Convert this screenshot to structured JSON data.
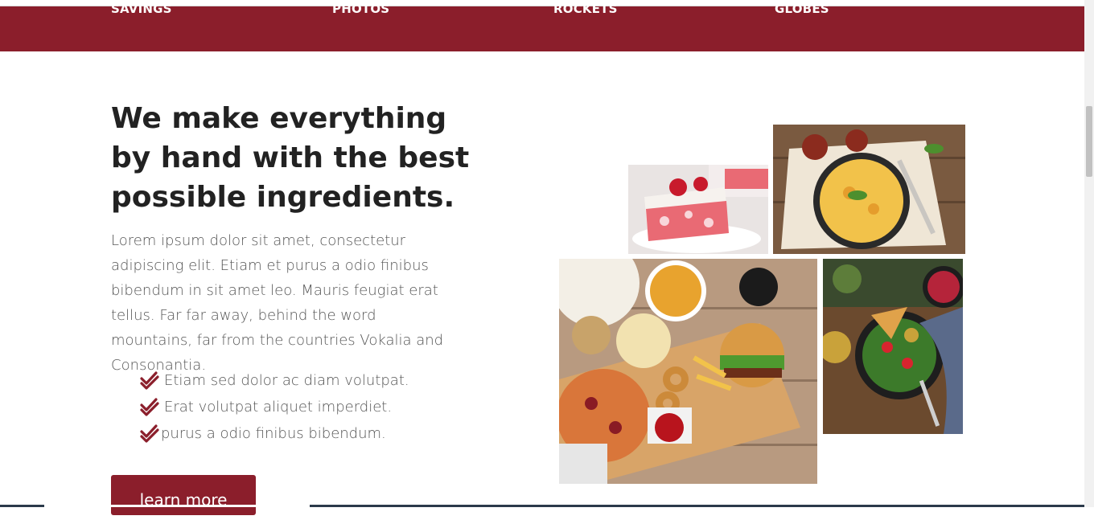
{
  "nav": {
    "items": [
      "SAVINGS",
      "PHOTOS",
      "ROCKETS",
      "GLOBES"
    ]
  },
  "content": {
    "headline": "We make everything by hand with the best possible ingredients.",
    "paragraph": "Lorem ipsum dolor sit amet, consectetur adipiscing elit. Etiam et purus a odio finibus bibendum in sit amet leo. Mauris feugiat erat tellus. Far far away, behind the word mountains, far from the countries Vokalia and Consonantia.",
    "checklist": [
      "Etiam sed dolor ac diam volutpat.",
      "Erat volutpat aliquet imperdiet.",
      "purus a odio finibus bibendum."
    ],
    "button_label": "learn more"
  },
  "colors": {
    "brand": "#8b1e2b",
    "text": "#222222",
    "muted": "#555555"
  },
  "icons": {
    "check": "double-check-icon"
  }
}
